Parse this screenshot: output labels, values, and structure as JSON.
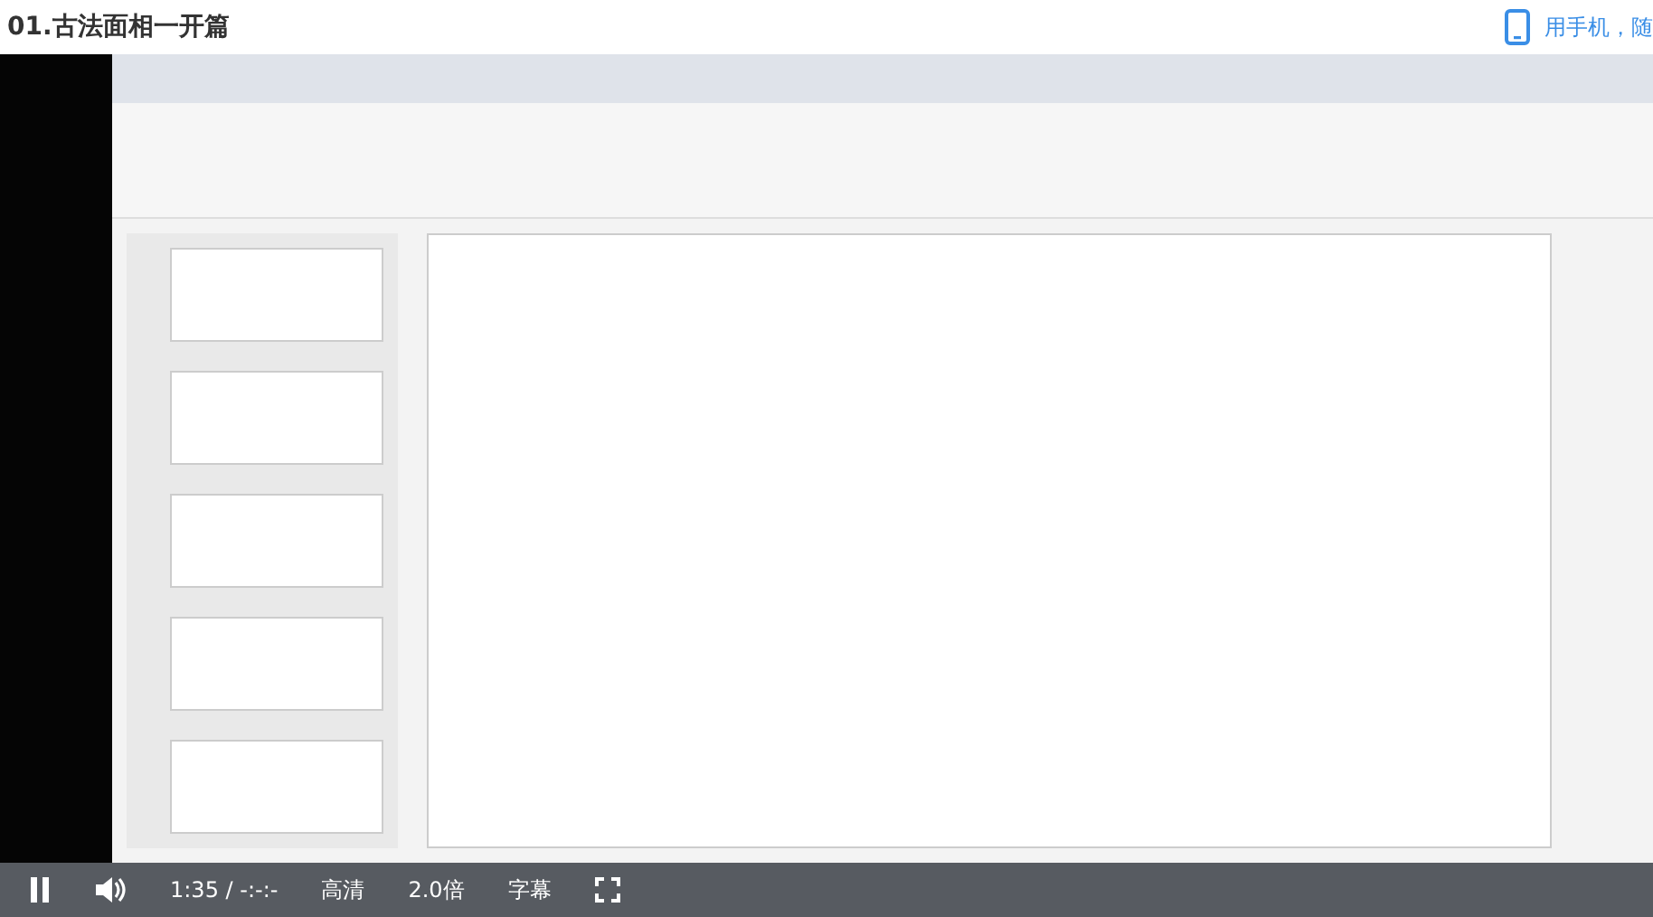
{
  "header": {
    "title": "01.古法面相一开篇",
    "mobile_prompt": "用手机，随"
  },
  "player": {
    "playing": true,
    "time": "1:35 / -:-:-",
    "quality": "高清",
    "speed": "2.0倍",
    "subtitles": "字幕"
  }
}
